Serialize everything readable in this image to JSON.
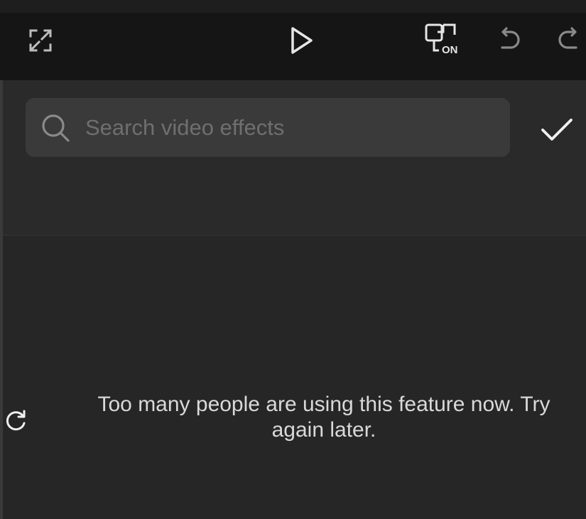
{
  "toolbar": {
    "icons": {
      "fullscreen": "fullscreen-icon",
      "play": "play-icon",
      "preview_toggle": "preview-on-icon",
      "undo": "undo-icon",
      "redo": "redo-icon"
    },
    "preview_toggle_badge": "ON"
  },
  "search": {
    "placeholder": "Search video effects",
    "value": "",
    "icon": "search-icon",
    "confirm_icon": "checkmark-icon"
  },
  "status": {
    "message": "Too many people are using this feature now. Try\nagain later.",
    "retry_icon": "refresh-icon"
  },
  "colors": {
    "toolbar_bg": "#151515",
    "panel_bg": "#262626",
    "search_bg": "#3a3a3a",
    "icon": "#e6e6e6",
    "placeholder": "#6f6f6f",
    "text": "#d9d9d9"
  }
}
